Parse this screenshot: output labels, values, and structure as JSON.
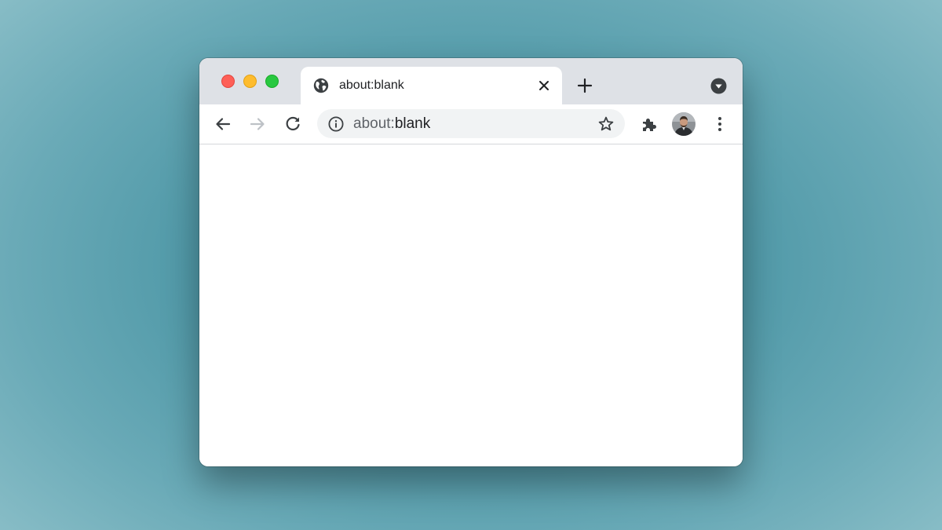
{
  "window": {
    "traffic_lights": [
      "close",
      "minimize",
      "zoom"
    ]
  },
  "tab": {
    "favicon": "globe-icon",
    "title": "about:blank",
    "close_icon": "close-icon"
  },
  "tabstrip": {
    "new_tab_icon": "plus-icon",
    "tab_search_icon": "chevron-down-circle-icon"
  },
  "toolbar": {
    "back_icon": "arrow-left-icon",
    "forward_icon": "arrow-right-icon",
    "reload_icon": "reload-icon",
    "omnibox": {
      "info_icon": "info-icon",
      "url_scheme": "about:",
      "url_rest": "blank",
      "bookmark_icon": "star-icon"
    },
    "extensions_icon": "puzzle-icon",
    "profile_icon": "avatar",
    "menu_icon": "kebab-menu-icon"
  },
  "colors": {
    "background": "#4d97a6",
    "titlebar": "#dee1e6",
    "omnibox": "#f1f3f4",
    "icon": "#5f6368",
    "icon_disabled": "#bdc1c6",
    "close_red": "#fe5f57",
    "minimize_yellow": "#febc2e",
    "zoom_green": "#28c840"
  }
}
